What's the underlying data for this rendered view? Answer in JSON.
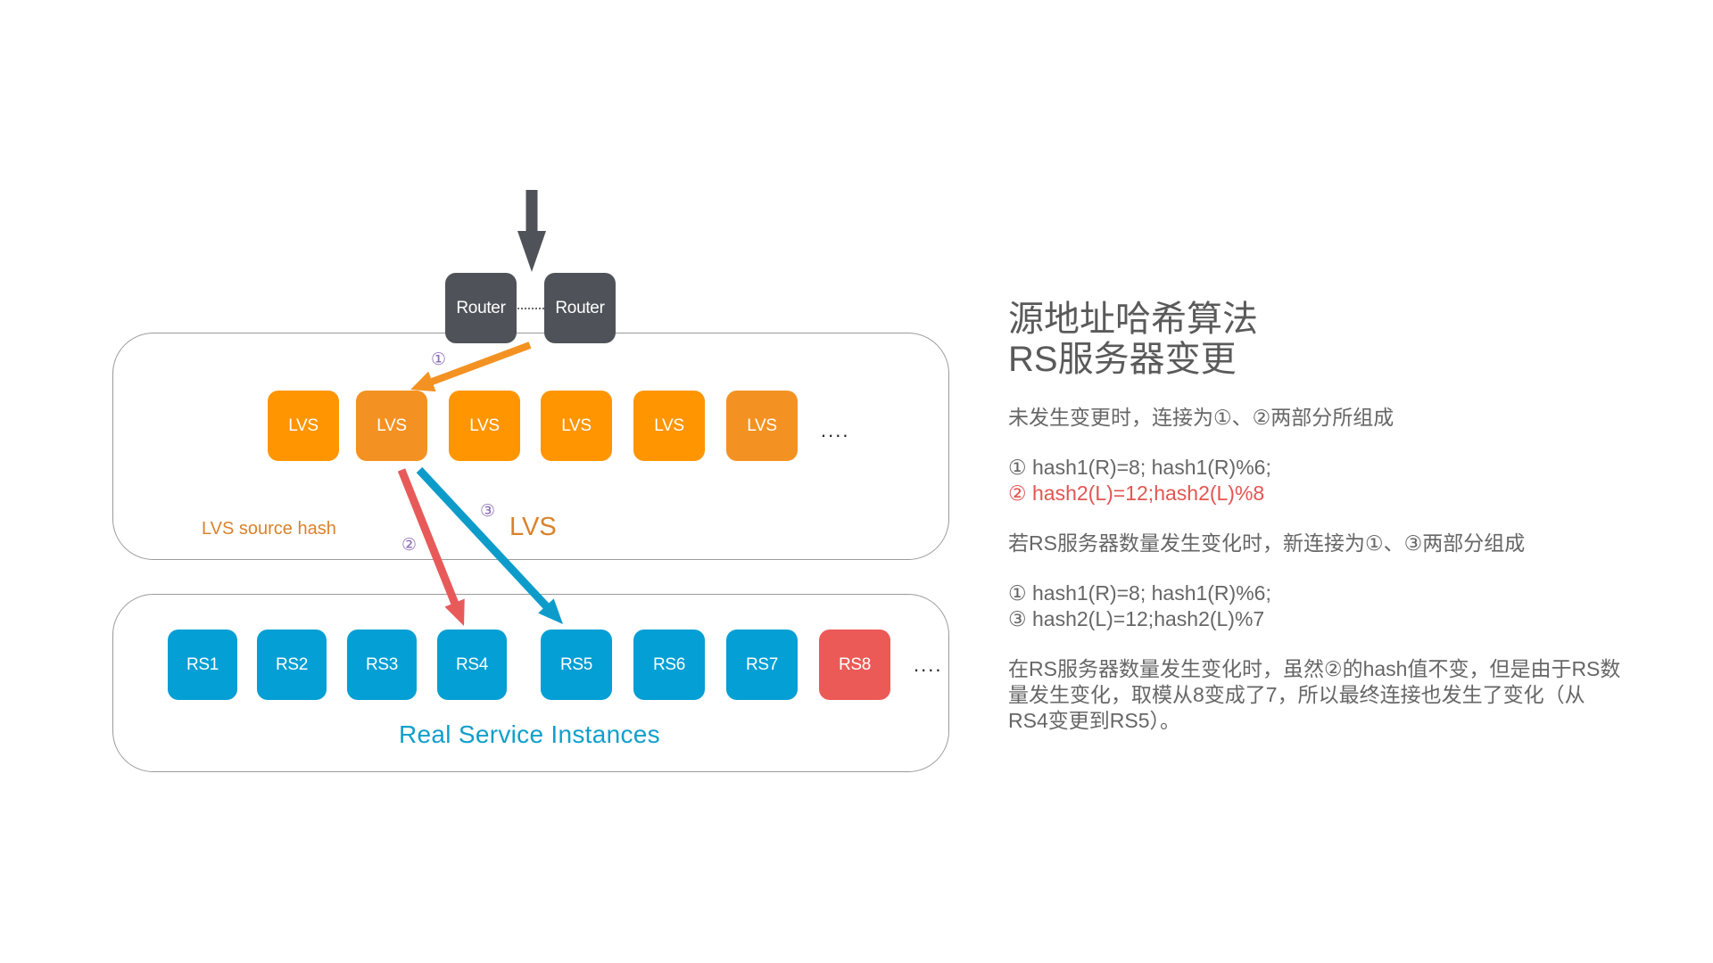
{
  "diagram": {
    "routers": [
      {
        "label": "Router"
      },
      {
        "label": "Router"
      }
    ],
    "lvs_nodes": [
      {
        "label": "LVS",
        "color": "#ff9500"
      },
      {
        "label": "LVS",
        "color": "#f39222"
      },
      {
        "label": "LVS",
        "color": "#ff9500"
      },
      {
        "label": "LVS",
        "color": "#ff9500"
      },
      {
        "label": "LVS",
        "color": "#ff9500"
      },
      {
        "label": "LVS",
        "color": "#f39222"
      }
    ],
    "lvs_more": "....",
    "rs_nodes": [
      {
        "label": "RS1",
        "color": "#049fd4"
      },
      {
        "label": "RS2",
        "color": "#049fd4"
      },
      {
        "label": "RS3",
        "color": "#049fd4"
      },
      {
        "label": "RS4",
        "color": "#049fd4"
      },
      {
        "label": "RS5",
        "color": "#049fd4"
      },
      {
        "label": "RS6",
        "color": "#049fd4"
      },
      {
        "label": "RS7",
        "color": "#049fd4"
      },
      {
        "label": "RS8",
        "color": "#eb5a56"
      }
    ],
    "rs_more": "....",
    "lvs_source_hash_label": "LVS source hash",
    "lvs_label": "LVS",
    "rs_group_label": "Real Service Instances",
    "path_labels": {
      "one": "①",
      "two": "②",
      "three": "③"
    },
    "colors": {
      "router": "#4f5359",
      "incoming_arrow": "#4f5359",
      "path_one": "#f39222",
      "path_two": "#e85a5a",
      "path_three": "#0d9cca",
      "label_purple": "#8a6ab8"
    }
  },
  "panel": {
    "title_line1": "源地址哈希算法",
    "title_line2": "RS服务器变更",
    "before_heading": "未发生变更时，连接为①、②两部分所组成",
    "before_line1": "① hash1(R)=8; hash1(R)%6;",
    "before_line2": "② hash2(L)=12;hash2(L)%8",
    "after_heading": "若RS服务器数量发生变化时，新连接为①、③两部分组成",
    "after_line1": "① hash1(R)=8; hash1(R)%6;",
    "after_line2": "③ hash2(L)=12;hash2(L)%7",
    "explanation": "在RS服务器数量发生变化时，虽然②的hash值不变，但是由于RS数量发生变化，取模从8变成了7，所以最终连接也发生了变化（从RS4变更到RS5）。"
  }
}
